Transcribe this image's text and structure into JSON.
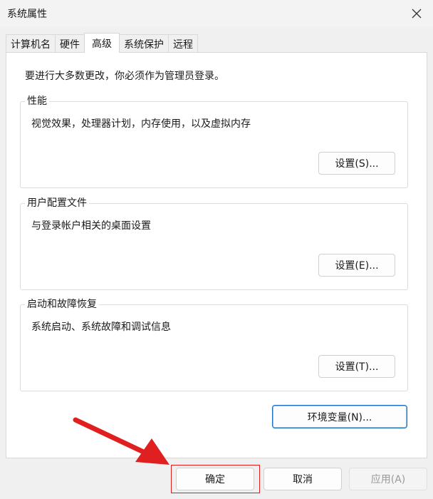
{
  "window": {
    "title": "系统属性"
  },
  "tabs": [
    {
      "label": "计算机名"
    },
    {
      "label": "硬件"
    },
    {
      "label": "高级"
    },
    {
      "label": "系统保护"
    },
    {
      "label": "远程"
    }
  ],
  "admin_note": "要进行大多数更改，你必须作为管理员登录。",
  "groups": {
    "performance": {
      "title": "性能",
      "description": "视觉效果，处理器计划，内存使用，以及虚拟内存",
      "button": "设置(S)..."
    },
    "user_profiles": {
      "title": "用户配置文件",
      "description": "与登录帐户相关的桌面设置",
      "button": "设置(E)..."
    },
    "startup_recovery": {
      "title": "启动和故障恢复",
      "description": "系统启动、系统故障和调试信息",
      "button": "设置(T)..."
    }
  },
  "env_button": "环境变量(N)...",
  "footer": {
    "ok": "确定",
    "cancel": "取消",
    "apply": "应用(A)"
  },
  "colors": {
    "annotation": "#e02020",
    "focus_border": "#1e6fbf"
  },
  "icons": {
    "close": "close-icon",
    "arrow": "red-arrow-annotation"
  }
}
